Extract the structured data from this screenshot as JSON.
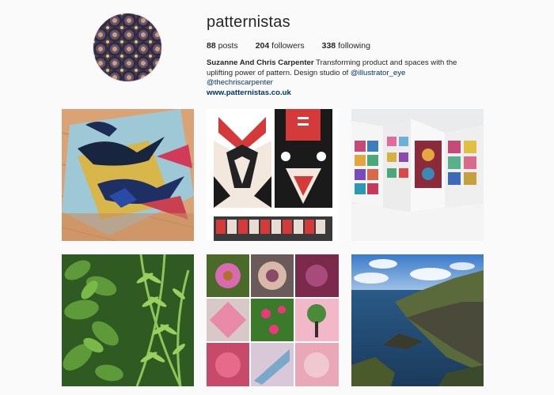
{
  "profile": {
    "username": "patternistas",
    "stats": {
      "posts_count": "88",
      "posts_label": "posts",
      "followers_count": "204",
      "followers_label": "followers",
      "following_count": "338",
      "following_label": "following"
    },
    "bio": {
      "name": "Suzanne And Chris Carpenter",
      "text": "Transforming product and spaces with the uplifting power of pattern. Design studio of",
      "mention1": "@illustrator_eye",
      "mention2": "@thechriscarpenter",
      "website": "www.patternistas.co.uk"
    }
  },
  "grid": {
    "posts": [
      {
        "subject": "bird-pattern-rug"
      },
      {
        "subject": "geometric-animal-prints"
      },
      {
        "subject": "folding-pattern-book"
      },
      {
        "subject": "green-foliage"
      },
      {
        "subject": "flower-pattern-collage"
      },
      {
        "subject": "coastal-cliffs"
      }
    ]
  },
  "colors": {
    "link": "#003569",
    "text": "#262626",
    "background": "#fafafa"
  }
}
